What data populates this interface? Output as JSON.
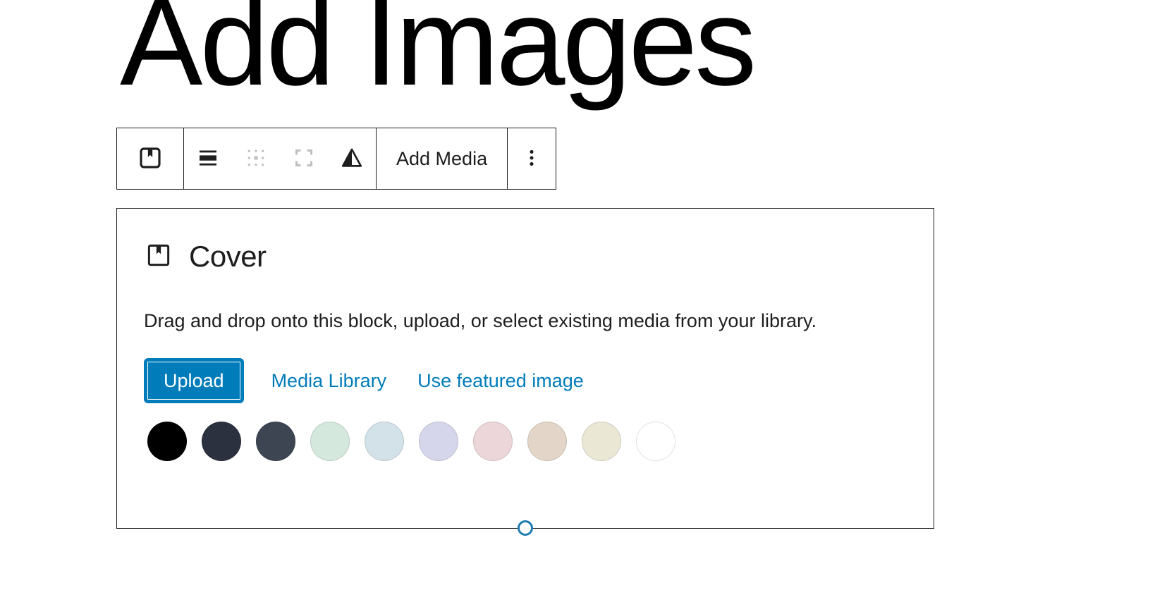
{
  "page": {
    "title": "Add Images"
  },
  "toolbar": {
    "block_type_icon": "cover-block-icon",
    "items": [
      {
        "name": "change-block-type-button",
        "icon": "cover-block-icon",
        "label": "",
        "disabled": false
      },
      {
        "name": "align-button",
        "icon": "align-full-width-icon",
        "label": "",
        "disabled": false
      },
      {
        "name": "focal-point-button",
        "icon": "focal-point-picker-icon",
        "label": "",
        "disabled": true
      },
      {
        "name": "crop-button",
        "icon": "crop-frame-icon",
        "label": "",
        "disabled": true
      },
      {
        "name": "duotone-button",
        "icon": "contrast-triangle-icon",
        "label": "",
        "disabled": false
      }
    ],
    "add_media_label": "Add Media",
    "more_options_icon": "vertical-ellipsis-icon"
  },
  "cover_block": {
    "icon": "cover-block-icon",
    "title": "Cover",
    "instructions": "Drag and drop onto this block, upload, or select existing media from your library.",
    "upload_label": "Upload",
    "media_library_label": "Media Library",
    "featured_image_label": "Use featured image",
    "accent_color": "#007cba",
    "resize_handle_color": "#1f7cb0",
    "swatches": [
      {
        "name": "swatch-black",
        "color": "#000000"
      },
      {
        "name": "swatch-dark-navy",
        "color": "#2b313f"
      },
      {
        "name": "swatch-dark-slate",
        "color": "#3c4551"
      },
      {
        "name": "swatch-pale-mint",
        "color": "#d5e8dd"
      },
      {
        "name": "swatch-pale-blue",
        "color": "#d3e2e8"
      },
      {
        "name": "swatch-pale-lavender",
        "color": "#d5d6ec"
      },
      {
        "name": "swatch-dusty-rose",
        "color": "#ecd6d9"
      },
      {
        "name": "swatch-warm-tan",
        "color": "#e3d6c8"
      },
      {
        "name": "swatch-cream",
        "color": "#eae7d5"
      },
      {
        "name": "swatch-white",
        "color": "#ffffff"
      }
    ]
  }
}
